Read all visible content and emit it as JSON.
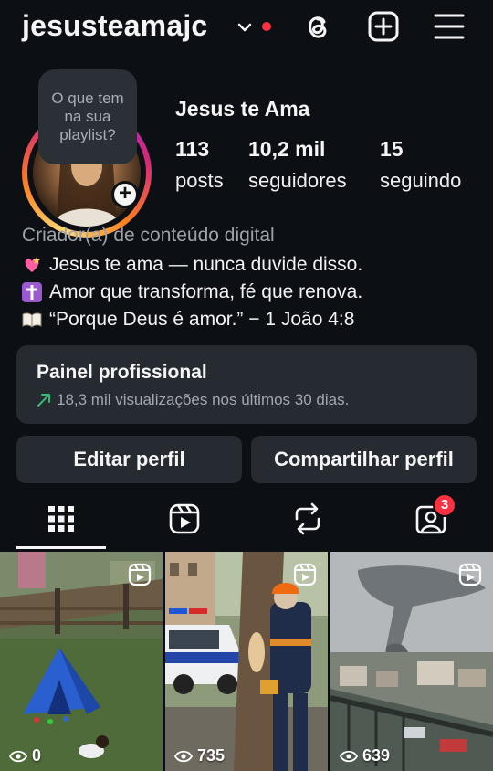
{
  "header": {
    "username": "jesusteamajc",
    "icons": [
      "chevron-down-icon",
      "threads-icon",
      "add-post-icon",
      "menu-icon"
    ],
    "notification_color": "#ff3040"
  },
  "profile": {
    "note": "O que tem na sua playlist?",
    "display_name": "Jesus te Ama",
    "stats": [
      {
        "value": "113",
        "label": "posts"
      },
      {
        "value": "10,2 mil",
        "label": "seguidores"
      },
      {
        "value": "15",
        "label": "seguindo"
      }
    ],
    "category": "Criador(a) de conteúdo digital",
    "bio": [
      {
        "icon": "heart-emoji",
        "text": "Jesus te ama — nunca duvide disso."
      },
      {
        "icon": "cross-emoji",
        "text": "Amor que transforma, fé que renova."
      },
      {
        "icon": "book-emoji",
        "text": "“Porque Deus é amor.” − 1 João 4:8"
      }
    ]
  },
  "dashboard": {
    "title": "Painel profissional",
    "subtitle": "18,3 mil visualizações nos últimos 30 dias."
  },
  "actions": {
    "edit": "Editar perfil",
    "share": "Compartilhar perfil"
  },
  "tabs": {
    "items": [
      "grid-icon",
      "reels-icon",
      "reposts-icon",
      "tagged-icon"
    ],
    "tagged_badge": "3"
  },
  "grid": [
    {
      "views": "0",
      "scene": "backyard with blue tent"
    },
    {
      "views": "735",
      "scene": "worker cutting tree near police car"
    },
    {
      "views": "639",
      "scene": "tornado over town"
    }
  ]
}
